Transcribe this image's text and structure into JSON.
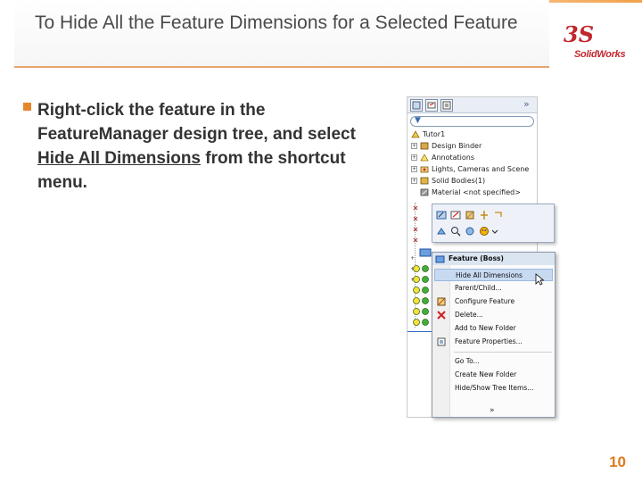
{
  "slide": {
    "title": "To Hide All the Feature Dimensions for a Selected Feature",
    "page_number": "10"
  },
  "logo": {
    "text": "SolidWorks",
    "mark": "3S"
  },
  "bullet": {
    "text_before": "Right-click the feature in the FeatureManager design tree, and select ",
    "emphasis": "Hide All Dimensions",
    "text_after": " from the shortcut menu."
  },
  "feature_tree": {
    "expand_glyph": "»",
    "filter_icon": "filter-icon",
    "items": [
      {
        "label": "Tutor1",
        "expandable": false,
        "icon": "part-icon"
      },
      {
        "label": "Design Binder",
        "expandable": true,
        "icon": "binder-icon"
      },
      {
        "label": "Annotations",
        "expandable": true,
        "icon": "annotations-icon"
      },
      {
        "label": "Lights, Cameras and Scene",
        "expandable": true,
        "icon": "lights-icon"
      },
      {
        "label": "Solid Bodies(1)",
        "expandable": true,
        "icon": "solid-bodies-icon"
      },
      {
        "label": "Material <not specified>",
        "expandable": false,
        "icon": "material-icon"
      }
    ]
  },
  "context_menu": {
    "header": "Feature (Boss)",
    "items": [
      {
        "label": "Hide All Dimensions",
        "highlighted": true,
        "icon": ""
      },
      {
        "label": "Parent/Child...",
        "highlighted": false,
        "icon": ""
      },
      {
        "label": "Configure Feature",
        "highlighted": false,
        "icon": "configure-icon"
      },
      {
        "label": "Delete...",
        "highlighted": false,
        "icon": "delete-icon"
      },
      {
        "label": "Add to New Folder",
        "highlighted": false,
        "icon": ""
      },
      {
        "label": "Feature Properties...",
        "highlighted": false,
        "icon": "properties-icon"
      }
    ],
    "items2": [
      {
        "label": "Go To..."
      },
      {
        "label": "Create New Folder"
      },
      {
        "label": "Hide/Show Tree Items..."
      }
    ],
    "more_glyph": "»"
  },
  "colors": {
    "accent": "#e8862c",
    "logo": "#c0282d",
    "highlight": "#c8daf2"
  }
}
